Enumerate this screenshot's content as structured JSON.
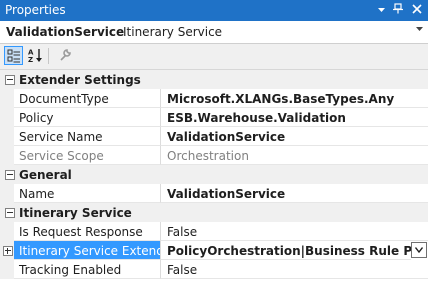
{
  "window": {
    "title": "Properties"
  },
  "object_selector": {
    "name": "ValidationService",
    "type": "Itinerary Service"
  },
  "categories": [
    {
      "name": "Extender Settings",
      "rows": [
        {
          "label": "DocumentType",
          "value": "Microsoft.XLANGs.BaseTypes.Any"
        },
        {
          "label": "Policy",
          "value": "ESB.Warehouse.Validation"
        },
        {
          "label": "Service Name",
          "value": "ValidationService"
        },
        {
          "label": "Service Scope",
          "value": "Orchestration"
        }
      ]
    },
    {
      "name": "General",
      "rows": [
        {
          "label": "Name",
          "value": "ValidationService"
        }
      ]
    },
    {
      "name": "Itinerary Service",
      "rows": [
        {
          "label": "Is Request Response",
          "value": "False"
        },
        {
          "label": "Itinerary Service Extender",
          "value": "PolicyOrchestration|Business Rule Policy Ore"
        },
        {
          "label": "Tracking Enabled",
          "value": "False"
        }
      ]
    }
  ],
  "colors": {
    "title_bar": "#1f72c7",
    "selection": "#3399ff"
  }
}
